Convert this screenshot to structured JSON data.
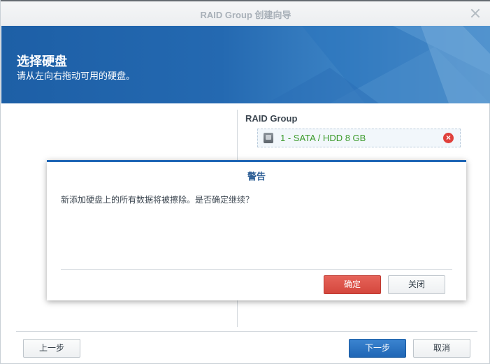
{
  "window": {
    "title": "RAID Group 创建向导"
  },
  "banner": {
    "heading": "选择硬盘",
    "subtitle": "请从左向右拖动可用的硬盘。"
  },
  "raid_group": {
    "title": "RAID Group",
    "disks": [
      {
        "label": "1 - SATA / HDD 8 GB"
      }
    ]
  },
  "footer": {
    "back_label": "上一步",
    "next_label": "下一步",
    "cancel_label": "取消"
  },
  "dialog": {
    "title": "警告",
    "message": "新添加硬盘上的所有数据将被擦除。是否确定继续？",
    "confirm_label": "确定",
    "close_label": "关闭"
  },
  "colors": {
    "accent": "#1f66b5",
    "danger": "#d4473d",
    "disk_text": "#3a9a2a"
  }
}
